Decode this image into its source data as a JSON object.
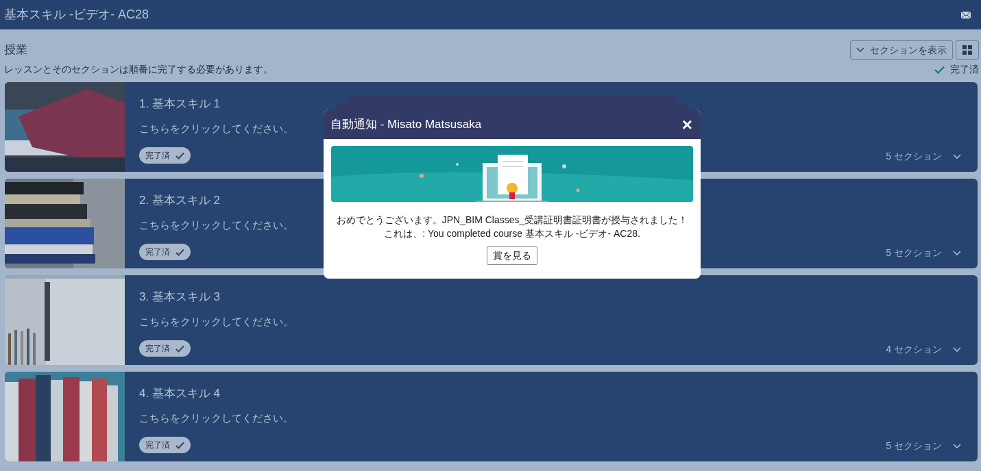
{
  "header": {
    "title": "基本スキル -ビデオ- AC28"
  },
  "section": {
    "title": "授業",
    "view_button": "セクションを表示",
    "note": "レッスンとそのセクションは順番に完了する必要があります。",
    "status": "完了済"
  },
  "lessons": [
    {
      "title": "1. 基本スキル 1",
      "subtitle": "こちらをクリックしてください。",
      "badge": "完了済",
      "completed": true,
      "sections": "5 セクション"
    },
    {
      "title": "2. 基本スキル 2",
      "subtitle": "こちらをクリックしてください。",
      "badge": "完了済",
      "completed": true,
      "sections": "5 セクション"
    },
    {
      "title": "3. 基本スキル 3",
      "subtitle": "こちらをクリックしてください。",
      "badge": "完了済",
      "completed": true,
      "sections": "4 セクション"
    },
    {
      "title": "4. 基本スキル 4",
      "subtitle": "こちらをクリックしてください。",
      "badge": "完了済",
      "completed": true,
      "sections": "5 セクション"
    }
  ],
  "modal": {
    "title": "自動通知 - Misato Matsusaka",
    "close": "×",
    "message_lines": [
      "おめでとうございます。JPN_BIM Classes_受講証明書証明書が授与されました！",
      "これは、: You completed course 基本スキル -ビデオ- AC28."
    ],
    "button": "賞を見る"
  }
}
